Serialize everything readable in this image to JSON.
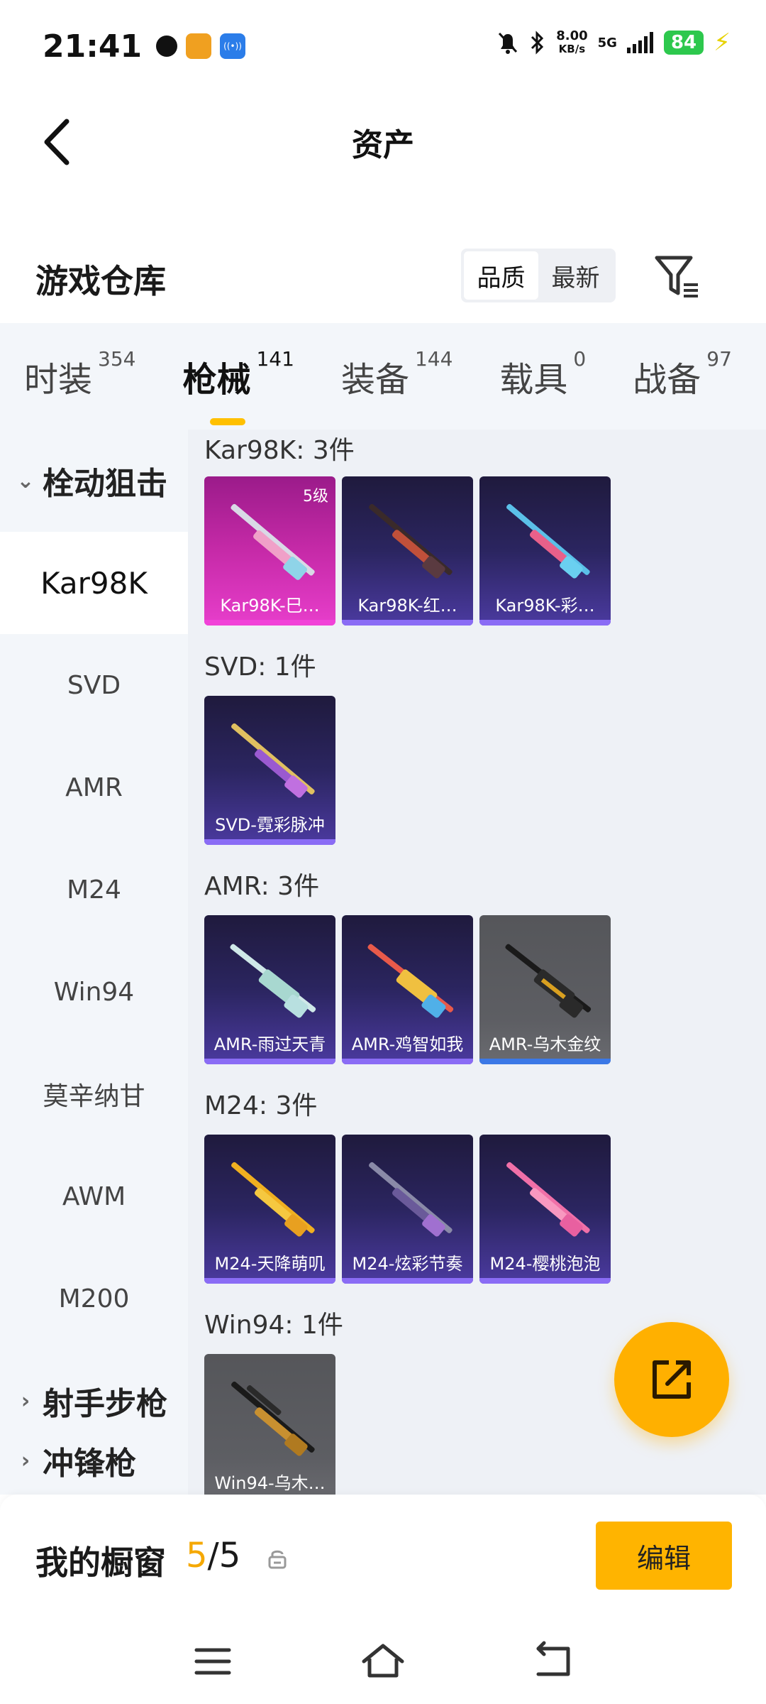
{
  "status_bar": {
    "time": "21:41",
    "network_speed_value": "8.00",
    "network_speed_unit": "KB/s",
    "signal": "5G",
    "battery": "84"
  },
  "header": {
    "title": "资产"
  },
  "warehouse": {
    "title": "游戏仓库",
    "sort_options": [
      "品质",
      "最新"
    ],
    "selected_sort": "品质"
  },
  "category_tabs": [
    {
      "label": "时装",
      "count": "354"
    },
    {
      "label": "枪械",
      "count": "141",
      "active": true
    },
    {
      "label": "装备",
      "count": "144"
    },
    {
      "label": "载具",
      "count": "0"
    },
    {
      "label": "战备",
      "count": "97"
    }
  ],
  "sidebar": {
    "group_sniper": "栓动狙击",
    "items": [
      "Kar98K",
      "SVD",
      "AMR",
      "M24",
      "Win94",
      "莫辛纳甘",
      "AWM",
      "M200"
    ],
    "active_item": "Kar98K",
    "group_marksman": "射手步枪",
    "group_partial": "冲锋枪"
  },
  "sections": [
    {
      "title": "Kar98K: 3件",
      "items": [
        {
          "label": "Kar98K-巳…",
          "style": "pink",
          "level": "5级"
        },
        {
          "label": "Kar98K-红…",
          "style": "purple"
        },
        {
          "label": "Kar98K-彩…",
          "style": "purple"
        }
      ]
    },
    {
      "title": "SVD: 1件",
      "items": [
        {
          "label": "SVD-霓彩脉冲",
          "style": "purple"
        }
      ]
    },
    {
      "title": "AMR: 3件",
      "items": [
        {
          "label": "AMR-雨过天青",
          "style": "purple"
        },
        {
          "label": "AMR-鸡智如我",
          "style": "purple"
        },
        {
          "label": "AMR-乌木金纹",
          "style": "gray"
        }
      ]
    },
    {
      "title": "M24: 3件",
      "items": [
        {
          "label": "M24-天降萌叽",
          "style": "purple"
        },
        {
          "label": "M24-炫彩节奏",
          "style": "purple"
        },
        {
          "label": "M24-樱桃泡泡",
          "style": "purple"
        }
      ]
    },
    {
      "title": "Win94: 1件",
      "items": [
        {
          "label": "Win94-乌木…",
          "style": "gray"
        }
      ]
    }
  ],
  "showcase": {
    "label": "我的橱窗",
    "used": "5",
    "separator": "/",
    "total": "5",
    "edit_label": "编辑"
  },
  "colors": {
    "accent": "#ffb400",
    "tab_bg": "#f3f6fa",
    "content_bg": "#eef1f6"
  }
}
